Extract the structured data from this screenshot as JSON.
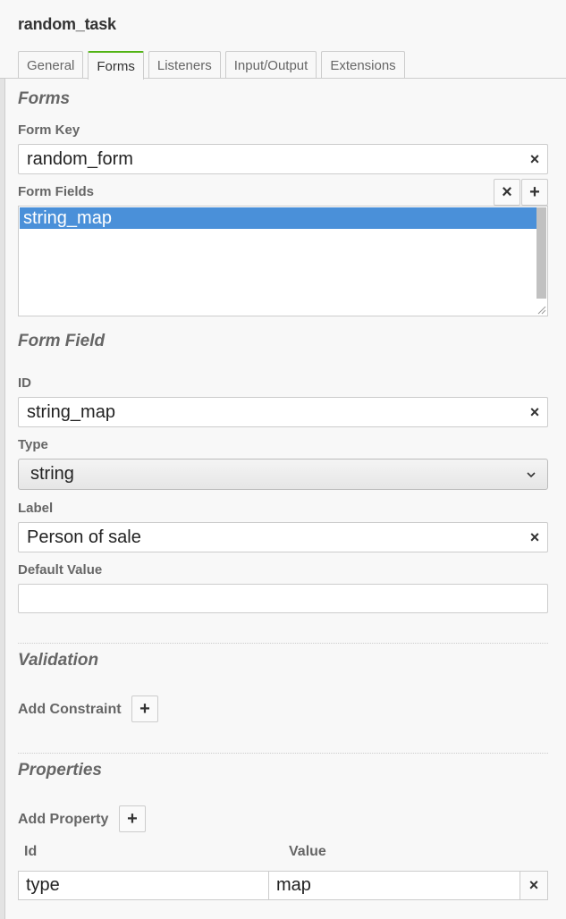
{
  "element": {
    "title": "random_task"
  },
  "tabs": [
    {
      "label": "General",
      "active": false
    },
    {
      "label": "Forms",
      "active": true
    },
    {
      "label": "Listeners",
      "active": false
    },
    {
      "label": "Input/Output",
      "active": false
    },
    {
      "label": "Extensions",
      "active": false
    }
  ],
  "forms_group": {
    "title": "Forms",
    "form_key": {
      "label": "Form Key",
      "value": "random_form",
      "clear_icon": "×"
    },
    "form_fields": {
      "label": "Form Fields",
      "remove_icon": "×",
      "add_icon": "+",
      "items": [
        "string_map"
      ],
      "selected": "string_map"
    }
  },
  "form_field_group": {
    "title": "Form Field",
    "id": {
      "label": "ID",
      "value": "string_map",
      "clear_icon": "×"
    },
    "type": {
      "label": "Type",
      "value": "string"
    },
    "field_label": {
      "label": "Label",
      "value": "Person of sale",
      "clear_icon": "×"
    },
    "default_value": {
      "label": "Default Value",
      "value": ""
    }
  },
  "validation_group": {
    "title": "Validation",
    "add_constraint_label": "Add Constraint",
    "add_icon": "+"
  },
  "properties_group": {
    "title": "Properties",
    "add_property_label": "Add Property",
    "add_icon": "+",
    "columns": {
      "id": "Id",
      "value": "Value"
    },
    "rows": [
      {
        "id": "type",
        "value": "map",
        "remove_icon": "×"
      }
    ]
  },
  "colors": {
    "accent_tab": "#52b415",
    "selection": "#4a90d9",
    "label": "#666666"
  }
}
